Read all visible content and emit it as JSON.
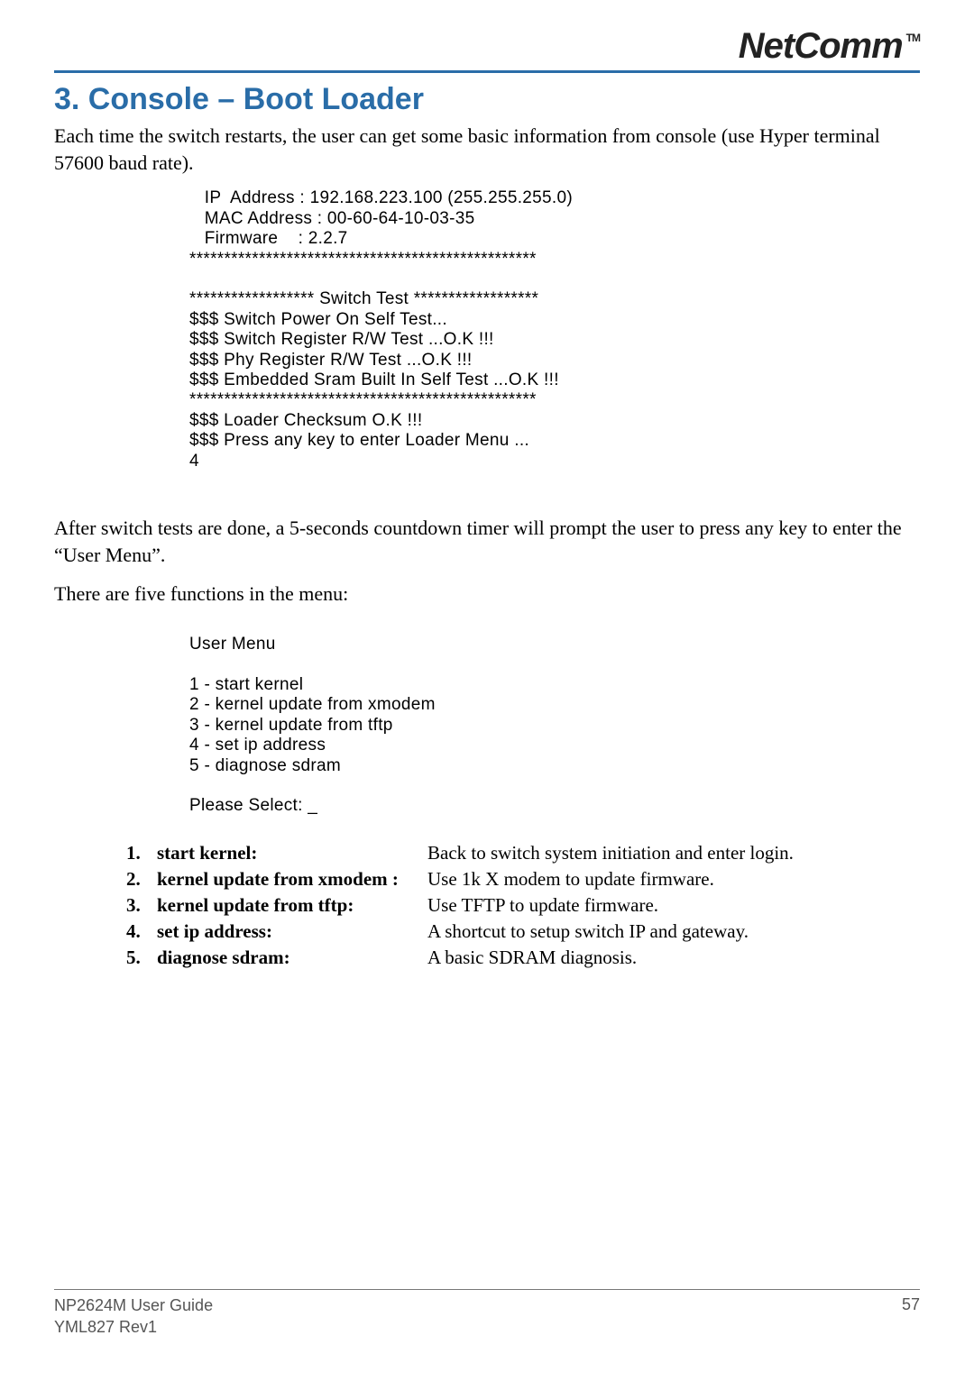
{
  "header": {
    "logo_text": "NetComm",
    "logo_tm": "TM"
  },
  "title": "3. Console – Boot Loader",
  "intro": "Each time the switch restarts, the user can get some basic information from console (use Hyper terminal 57600 baud rate).",
  "console_boot": "   IP  Address : 192.168.223.100 (255.255.255.0)\n   MAC Address : 00-60-64-10-03-35\n   Firmware    : 2.2.7\n**************************************************\n\n****************** Switch Test ******************\n$$$ Switch Power On Self Test...\n$$$ Switch Register R/W Test ...O.K !!!\n$$$ Phy Register R/W Test ...O.K !!!\n$$$ Embedded Sram Built In Self Test ...O.K !!!\n**************************************************\n$$$ Loader Checksum O.K !!!\n$$$ Press any key to enter Loader Menu ...\n4",
  "after_tests": "After switch tests are done, a 5-seconds countdown timer will prompt the user to press any key to enter the “User Menu”.",
  "five_functions": "There are five functions in the menu:",
  "console_menu": "User Menu\n\n1 - start kernel\n2 - kernel update from xmodem\n3 - kernel update from tftp\n4 - set ip address\n5 - diagnose sdram\n\nPlease Select: _",
  "functions": [
    {
      "n": "1.",
      "term": "start kernel:",
      "desc": "Back to switch system initiation and enter login."
    },
    {
      "n": "2.",
      "term": "kernel update from xmodem :",
      "desc": "Use 1k X modem to update firmware."
    },
    {
      "n": "3.",
      "term": "kernel update from tftp:",
      "desc": "Use TFTP to update firmware."
    },
    {
      "n": "4.",
      "term": "set ip address:",
      "desc": "A shortcut to setup switch IP and gateway."
    },
    {
      "n": "5.",
      "term": "diagnose sdram:",
      "desc": "A basic SDRAM diagnosis."
    }
  ],
  "footer": {
    "guide": "NP2624M User Guide",
    "rev": "YML827 Rev1",
    "page": "57"
  }
}
